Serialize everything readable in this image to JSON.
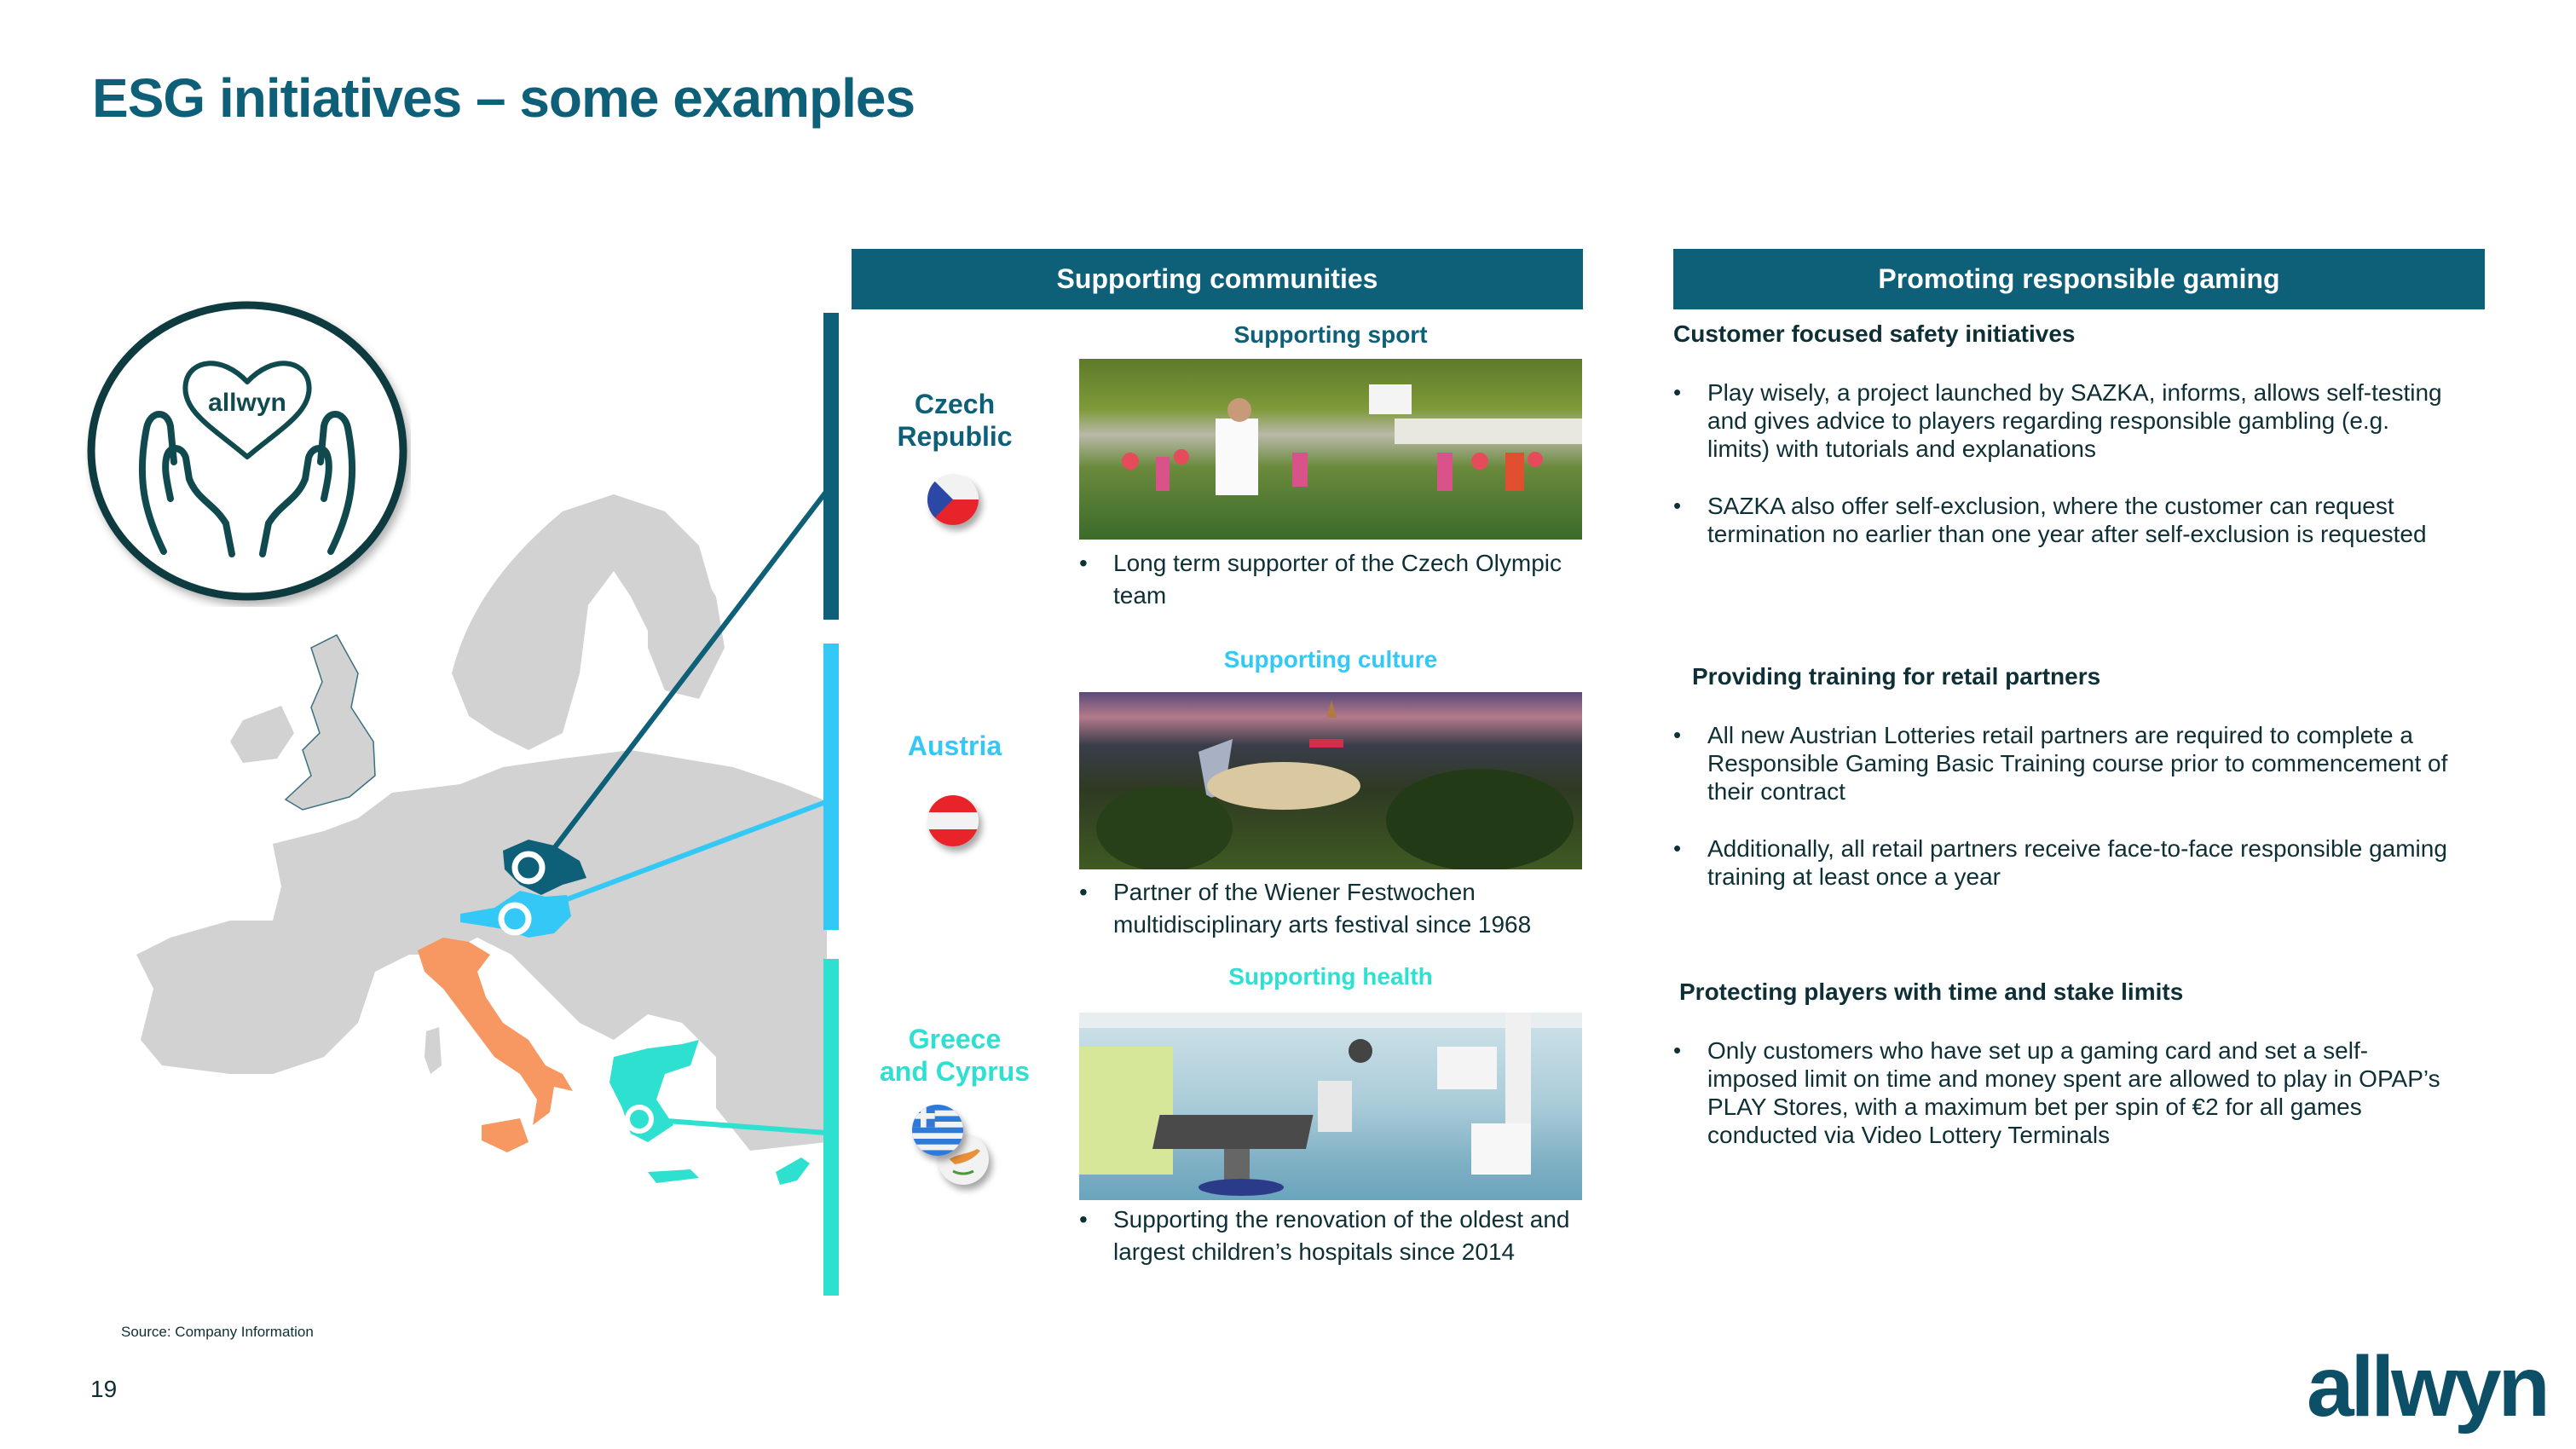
{
  "title": "ESG initiatives – some examples",
  "colors": {
    "brand_dark": "#0e5f78",
    "czech_accent": "#0e5f78",
    "austria_accent": "#33c8f5",
    "greece_accent": "#2de0cf",
    "italy_highlight": "#f79762",
    "map_grey": "#d2d2d2",
    "text_dark": "#0d2f35"
  },
  "logo_badge": {
    "heart_text": "allwyn"
  },
  "communities": {
    "header": "Supporting communities",
    "rows": [
      {
        "country": "Czech Republic",
        "country_lines": [
          "Czech",
          "Republic"
        ],
        "flag": "czech-flag",
        "subheading": "Supporting sport",
        "photo": "sport-photo",
        "bullet": "Long term supporter of the Czech Olympic team"
      },
      {
        "country": "Austria",
        "country_lines": [
          "Austria"
        ],
        "flag": "austria-flag",
        "subheading": "Supporting culture",
        "photo": "culture-photo",
        "bullet": "Partner of the Wiener Festwochen multidisciplinary arts festival since 1968"
      },
      {
        "country": "Greece and Cyprus",
        "country_lines": [
          "Greece",
          "and Cyprus"
        ],
        "flag": "greece-cyprus-flags",
        "subheading": "Supporting health",
        "photo": "health-photo",
        "bullet": "Supporting the renovation of the oldest and largest children’s hospitals since 2014"
      }
    ]
  },
  "responsible_gaming": {
    "header": "Promoting responsible gaming",
    "sections": [
      {
        "title": "Customer focused safety initiatives",
        "bullets": [
          "Play wisely, a project launched by SAZKA, informs, allows self-testing and gives advice to players regarding responsible gambling (e.g. limits) with tutorials and explanations",
          "SAZKA also offer self-exclusion, where the customer can request termination no earlier than one year after self-exclusion is requested"
        ]
      },
      {
        "title": "Providing training for retail partners",
        "bullets": [
          "All new Austrian Lotteries retail partners are required to complete a Responsible Gaming Basic Training course prior to commencement of their contract",
          "Additionally, all retail partners receive face-to-face responsible gaming training at least once a year"
        ]
      },
      {
        "title": "Protecting players with time and stake limits",
        "bullets": [
          "Only customers who have set up a gaming card and set a self-imposed limit on time and money spent are allowed to play in OPAP’s PLAY Stores, with a maximum bet per spin of €2 for all games conducted via Video Lottery Terminals"
        ]
      }
    ]
  },
  "footer": {
    "source": "Source: Company Information",
    "page_number": "19",
    "brand": "allwyn"
  }
}
